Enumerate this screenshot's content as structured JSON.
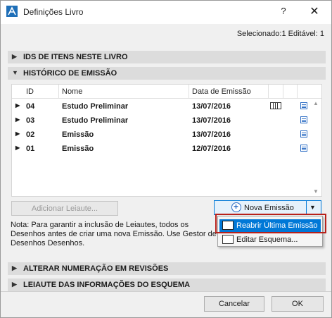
{
  "window": {
    "title": "Definições Livro",
    "help_label": "?",
    "close_label": "✕"
  },
  "selection_info": "Selecionado:1 Editável: 1",
  "sections": {
    "ids": "IDS DE ITENS NESTE LIVRO",
    "historico": "HISTÓRICO DE EMISSÃO",
    "numeracao": "ALTERAR NUMERAÇÃO EM REVISÕES",
    "leiaute": "LEIAUTE DAS INFORMAÇÕES DO ESQUEMA"
  },
  "table": {
    "headers": [
      "ID",
      "Nome",
      "Data de Emissão"
    ],
    "rows": [
      {
        "id": "04",
        "name": "Estudo Preliminar",
        "date": "13/07/2016",
        "has_book": true
      },
      {
        "id": "03",
        "name": "Estudo Preliminar",
        "date": "13/07/2016",
        "has_book": false
      },
      {
        "id": "02",
        "name": "Emissão",
        "date": "13/07/2016",
        "has_book": false
      },
      {
        "id": "01",
        "name": "Emissão",
        "date": "12/07/2016",
        "has_book": false
      }
    ]
  },
  "buttons": {
    "adicionar_leiaute": "Adicionar Leiaute...",
    "nova_emissao": "Nova Emissão",
    "cancelar": "Cancelar",
    "ok": "OK"
  },
  "note": "Nota: Para garantir a inclusão de Leiautes, todos os Desenhos antes de criar uma nova Emissão. Use Gestor de Desenhos Desenhos.",
  "dropdown": {
    "items": [
      "Reabrir Última Emissão",
      "Editar Esquema..."
    ],
    "selected_index": 0
  },
  "colors": {
    "accent": "#0078d7",
    "highlight": "#b8211b",
    "section_bg": "#dcdcdc"
  }
}
